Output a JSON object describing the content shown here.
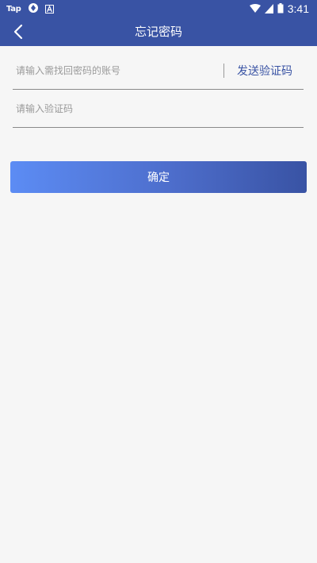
{
  "status_bar": {
    "app_tag": "Tap",
    "time": "3:41",
    "icons": [
      "vpn-icon",
      "font-a-icon",
      "wifi-icon",
      "signal-icon",
      "battery-icon"
    ]
  },
  "app_bar": {
    "back_icon": "chevron-left-icon",
    "title": "忘记密码"
  },
  "form": {
    "account_placeholder": "请输入需找回密码的账号",
    "send_code_label": "发送验证码",
    "code_placeholder": "请输入验证码",
    "confirm_label": "确定"
  },
  "colors": {
    "primary": "#3953a4",
    "gradient_start": "#5c8cf4",
    "background": "#f6f6f6"
  }
}
